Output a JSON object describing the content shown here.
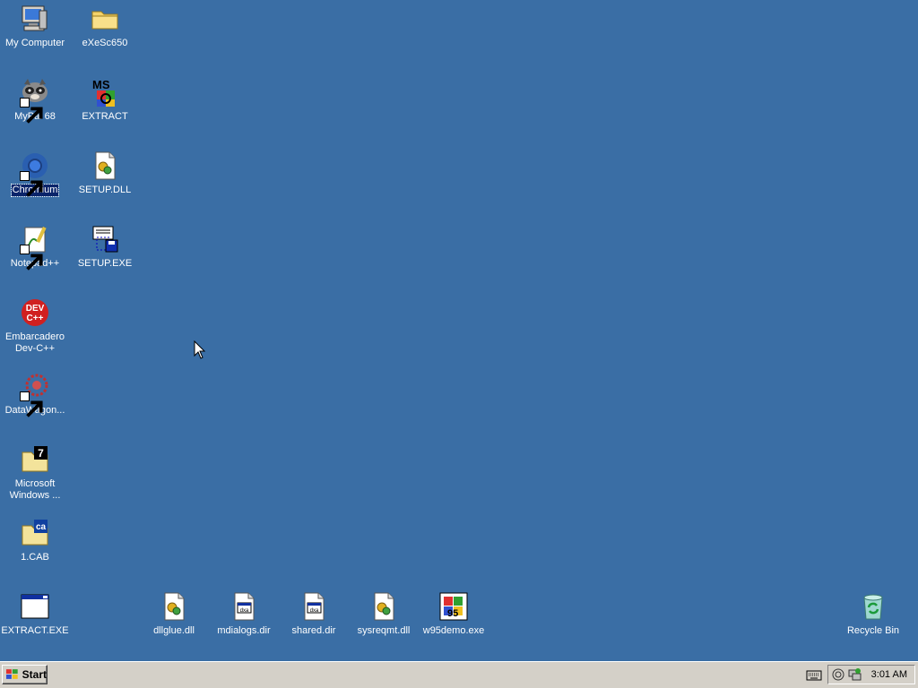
{
  "desktop": {
    "background_color": "#3a6ea5",
    "icons": [
      {
        "label": "My Computer"
      },
      {
        "label": "eXeSc650"
      },
      {
        "label": "MyPal 68"
      },
      {
        "label": "EXTRACT"
      },
      {
        "label": "Chromium"
      },
      {
        "label": "SETUP.DLL"
      },
      {
        "label": "Notepad++"
      },
      {
        "label": "SETUP.EXE"
      },
      {
        "label": "Embarcadero Dev-C++"
      },
      {
        "label": "DataWagon..."
      },
      {
        "label": "Microsoft Windows ..."
      },
      {
        "label": "1.CAB"
      },
      {
        "label": "EXTRACT.EXE"
      },
      {
        "label": "dllglue.dll"
      },
      {
        "label": "mdialogs.dir"
      },
      {
        "label": "shared.dir"
      },
      {
        "label": "sysreqmt.dll"
      },
      {
        "label": "w95demo.exe"
      },
      {
        "label": "Recycle Bin"
      }
    ]
  },
  "taskbar": {
    "start_label": "Start",
    "clock": "3:01 AM"
  }
}
